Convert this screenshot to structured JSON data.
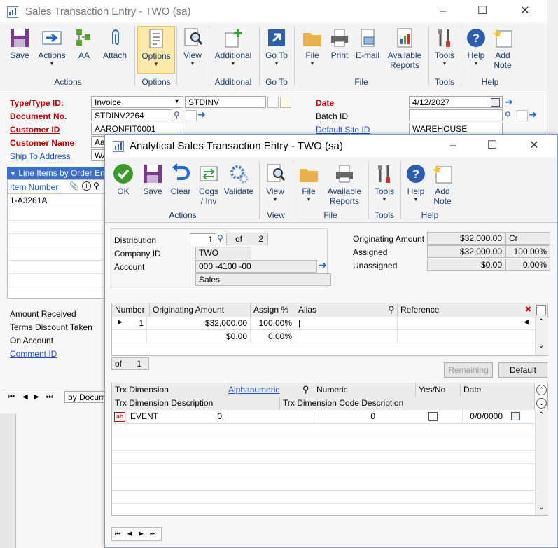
{
  "back_window": {
    "title": "Sales Transaction Entry  -  TWO (sa)",
    "ribbon": {
      "buttons": [
        "Save",
        "Actions",
        "AA",
        "Attach",
        "Options",
        "View",
        "Additional",
        "Go To",
        "File",
        "Print",
        "E-mail",
        "Available Reports",
        "Tools",
        "Help",
        "Add Note"
      ],
      "groups": [
        "Actions",
        "Options",
        "Additional",
        "Go To",
        "File",
        "Tools",
        "Help"
      ]
    },
    "fields": {
      "type_label": "Type/Type ID:",
      "type_value": "Invoice",
      "type_id_value": "STDINV",
      "docno_label": "Document No.",
      "docno_value": "STDINV2264",
      "custid_label": "Customer ID",
      "custid_value": "AARONFIT0001",
      "custname_label": "Customer Name",
      "custname_value": "Aar",
      "shipto_label": "Ship To Address",
      "shipto_value": "WA",
      "date_label": "Date",
      "date_value": "4/12/2027",
      "batch_label": "Batch ID",
      "batch_value": "",
      "site_label": "Default Site ID",
      "site_value": "WAREHOUSE"
    },
    "line_items": {
      "header": "Line Items by Order Ente",
      "col_item": "Item Number",
      "rows": [
        "1-A3261A"
      ]
    },
    "bottom_labels": [
      "Amount Received",
      "Terms Discount Taken",
      "On Account",
      "Comment ID"
    ],
    "browse": "by Docume"
  },
  "front_window": {
    "title": "Analytical Sales Transaction Entry  -  TWO (sa)",
    "ribbon": {
      "buttons": [
        "OK",
        "Save",
        "Clear",
        "Cogs / Inv",
        "Validate",
        "View",
        "File",
        "Available Reports",
        "Tools",
        "Help",
        "Add Note"
      ],
      "groups": [
        "Actions",
        "View",
        "File",
        "Tools",
        "Help"
      ]
    },
    "distribution": {
      "distribution_label": "Distribution",
      "distribution_value": "1",
      "of_label": "of",
      "of_value": "2",
      "company_label": "Company ID",
      "company_value": "TWO",
      "account_label": "Account",
      "account_value": "000 -4100 -00",
      "account_desc": "Sales"
    },
    "amounts": {
      "orig_label": "Originating Amount",
      "orig_value": "$32,000.00",
      "orig_type": "Cr",
      "assigned_label": "Assigned",
      "assigned_value": "$32,000.00",
      "assigned_pct": "100.00%",
      "unassigned_label": "Unassigned",
      "unassigned_value": "$0.00",
      "unassigned_pct": "0.00%"
    },
    "grid1": {
      "headers": [
        "Number",
        "Originating Amount",
        "Assign %",
        "Alias",
        "Reference"
      ],
      "rows": [
        {
          "number": "1",
          "amount": "$32,000.00",
          "pct": "100.00%",
          "alias": "|"
        },
        {
          "number": "",
          "amount": "$0.00",
          "pct": "0.00%",
          "alias": ""
        }
      ],
      "of_label": "of",
      "of_value": "1",
      "remaining_btn": "Remaining",
      "default_btn": "Default"
    },
    "grid2": {
      "headers": [
        "Trx Dimension",
        "Alphanumeric",
        "Numeric",
        "Yes/No",
        "Date"
      ],
      "headers2": [
        "Trx Dimension Description",
        "Trx Dimension Code Description"
      ],
      "row": {
        "badge": "ab",
        "dimension": "EVENT",
        "alpha": "0",
        "numeric": "0",
        "date": "0/0/0000"
      }
    }
  },
  "colors": {
    "accent": "#1f4fc4",
    "required": "#c00000",
    "ribbon_bg": "#f3f3f3"
  }
}
